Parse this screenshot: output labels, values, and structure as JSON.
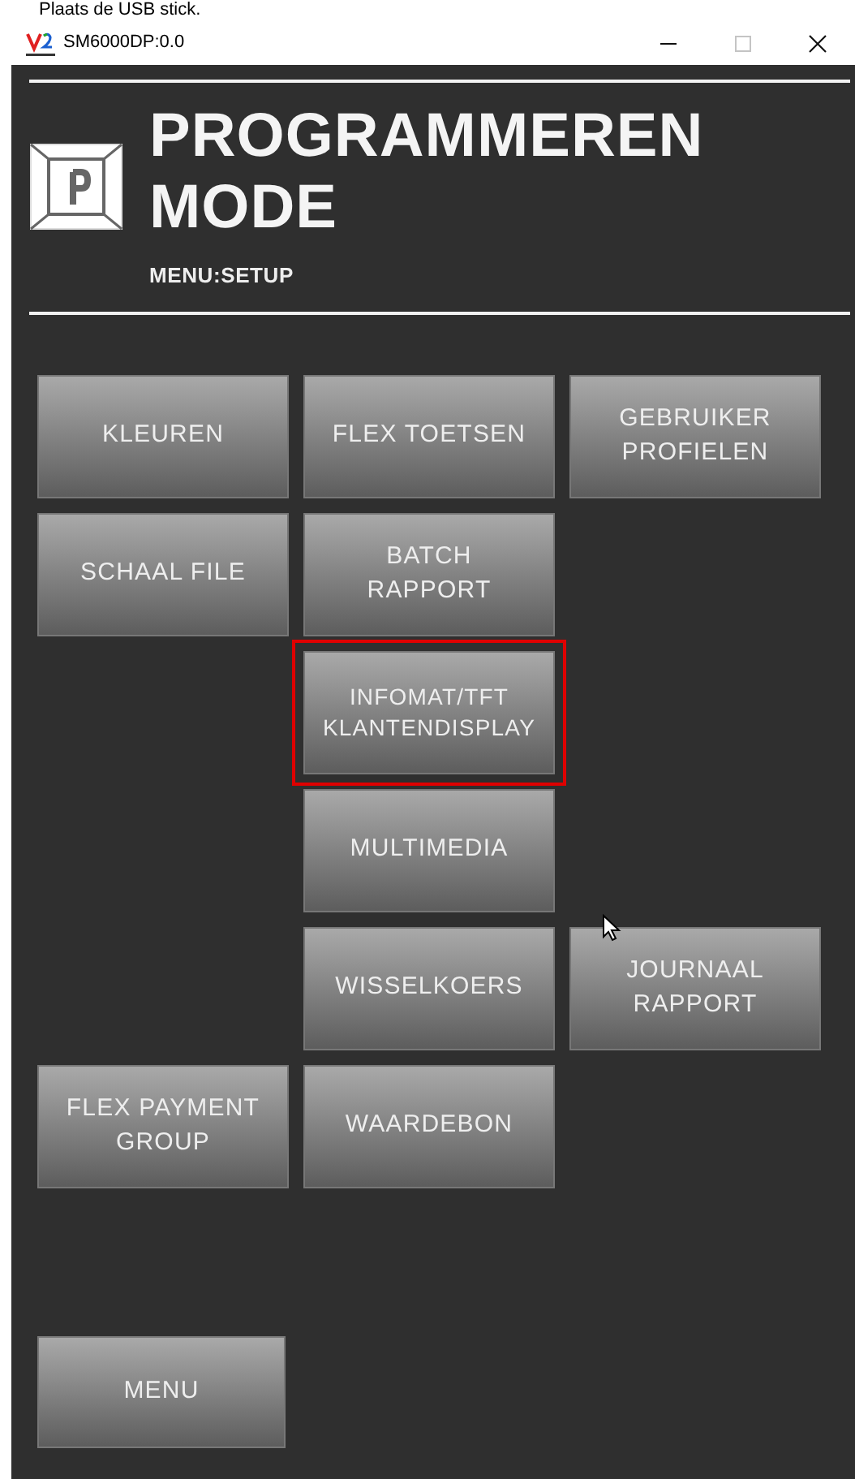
{
  "caption": "Plaats de USB stick.",
  "window": {
    "title": "SM6000DP:0.0",
    "controls": [
      {
        "kind": "minimize",
        "disabled": false
      },
      {
        "kind": "maximize",
        "disabled": true
      },
      {
        "kind": "close",
        "disabled": false
      }
    ]
  },
  "header": {
    "title": "PROGRAMMEREN MODE",
    "subtitle": "MENU:SETUP"
  },
  "grid_rows": [
    {
      "cells": [
        {
          "kind": "button",
          "label": "KLEUREN",
          "selected": false
        },
        {
          "kind": "button",
          "label": "FLEX TOETSEN",
          "selected": false
        },
        {
          "kind": "button",
          "label": "GEBRUIKER\nPROFIELEN",
          "selected": false
        }
      ]
    },
    {
      "cells": [
        {
          "kind": "button",
          "label": "SCHAAL FILE",
          "selected": false
        },
        {
          "kind": "button",
          "label": "BATCH\nRAPPORT",
          "selected": false
        },
        {
          "kind": "blank"
        }
      ]
    },
    {
      "cells": [
        {
          "kind": "blank"
        },
        {
          "kind": "button",
          "label": "INFOMAT/TFT\nKLANTENDISPLAY",
          "selected": true
        },
        {
          "kind": "blank"
        }
      ]
    },
    {
      "cells": [
        {
          "kind": "blank"
        },
        {
          "kind": "button",
          "label": "MULTIMEDIA",
          "selected": false
        },
        {
          "kind": "blank"
        }
      ]
    },
    {
      "cells": [
        {
          "kind": "blank"
        },
        {
          "kind": "button",
          "label": "WISSELKOERS",
          "selected": false
        },
        {
          "kind": "button",
          "label": "JOURNAAL\nRAPPORT",
          "selected": false
        }
      ]
    },
    {
      "cells": [
        {
          "kind": "button",
          "label": "FLEX PAYMENT\nGROUP",
          "selected": false
        },
        {
          "kind": "button",
          "label": "WAARDEBON",
          "selected": false
        },
        {
          "kind": "blank"
        }
      ]
    }
  ],
  "menu_button": {
    "label": "MENU"
  }
}
